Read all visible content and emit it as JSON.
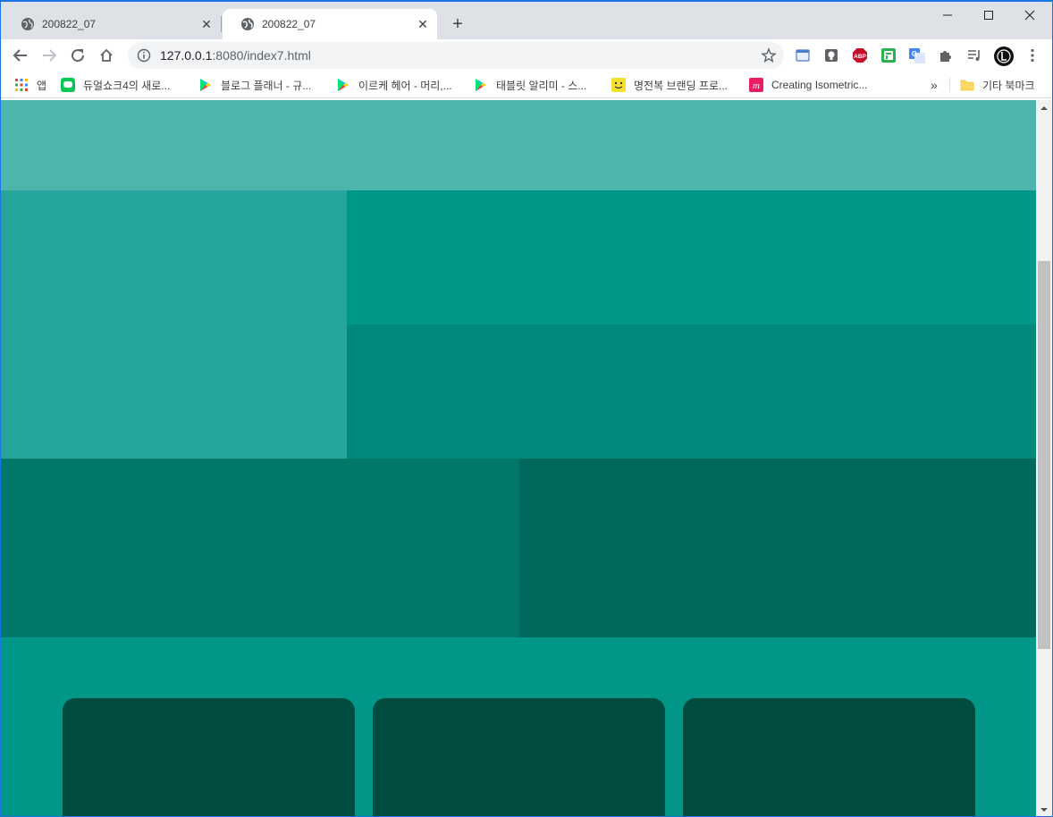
{
  "browser": {
    "tabs": [
      {
        "title": "200822_07",
        "icon": "globe-icon",
        "active": false
      },
      {
        "title": "200822_07",
        "icon": "globe-icon",
        "active": true
      }
    ],
    "new_tab_label": "+",
    "address": {
      "host": "127.0.0.1",
      "path": ":8080/index7.html"
    },
    "extensions": [
      "tab-manager-icon",
      "lightbulb-icon",
      "adblock-plus-icon",
      "feedly-icon",
      "google-translate-icon",
      "extensions-puzzle-icon",
      "media-control-icon",
      "profile-avatar-icon"
    ],
    "bookmarks": [
      {
        "label": "앱",
        "icon": "apps-grid-icon"
      },
      {
        "label": "듀얼쇼크4의 새로...",
        "icon": "line-icon"
      },
      {
        "label": "블로그 플래너 - 규...",
        "icon": "play-store-icon"
      },
      {
        "label": "이르케 헤어 - 머리,...",
        "icon": "play-store-icon"
      },
      {
        "label": "태블릿 알리미 - 스...",
        "icon": "play-store-icon"
      },
      {
        "label": "명전복 브랜딩 프로...",
        "icon": "smile-face-icon"
      },
      {
        "label": "Creating Isometric...",
        "icon": "m-logo-icon"
      }
    ],
    "other_bookmarks": "기타 북마크",
    "overflow_label": "»"
  },
  "page": {
    "colors": {
      "top": "#4db6ac",
      "left": "#26a69a",
      "right_top": "#009688",
      "right_bottom": "#00897b",
      "bottom_left": "#00796b",
      "bottom_right": "#00695c",
      "footer": "#009688",
      "card": "#004d40"
    },
    "cards": [
      {},
      {},
      {}
    ]
  }
}
